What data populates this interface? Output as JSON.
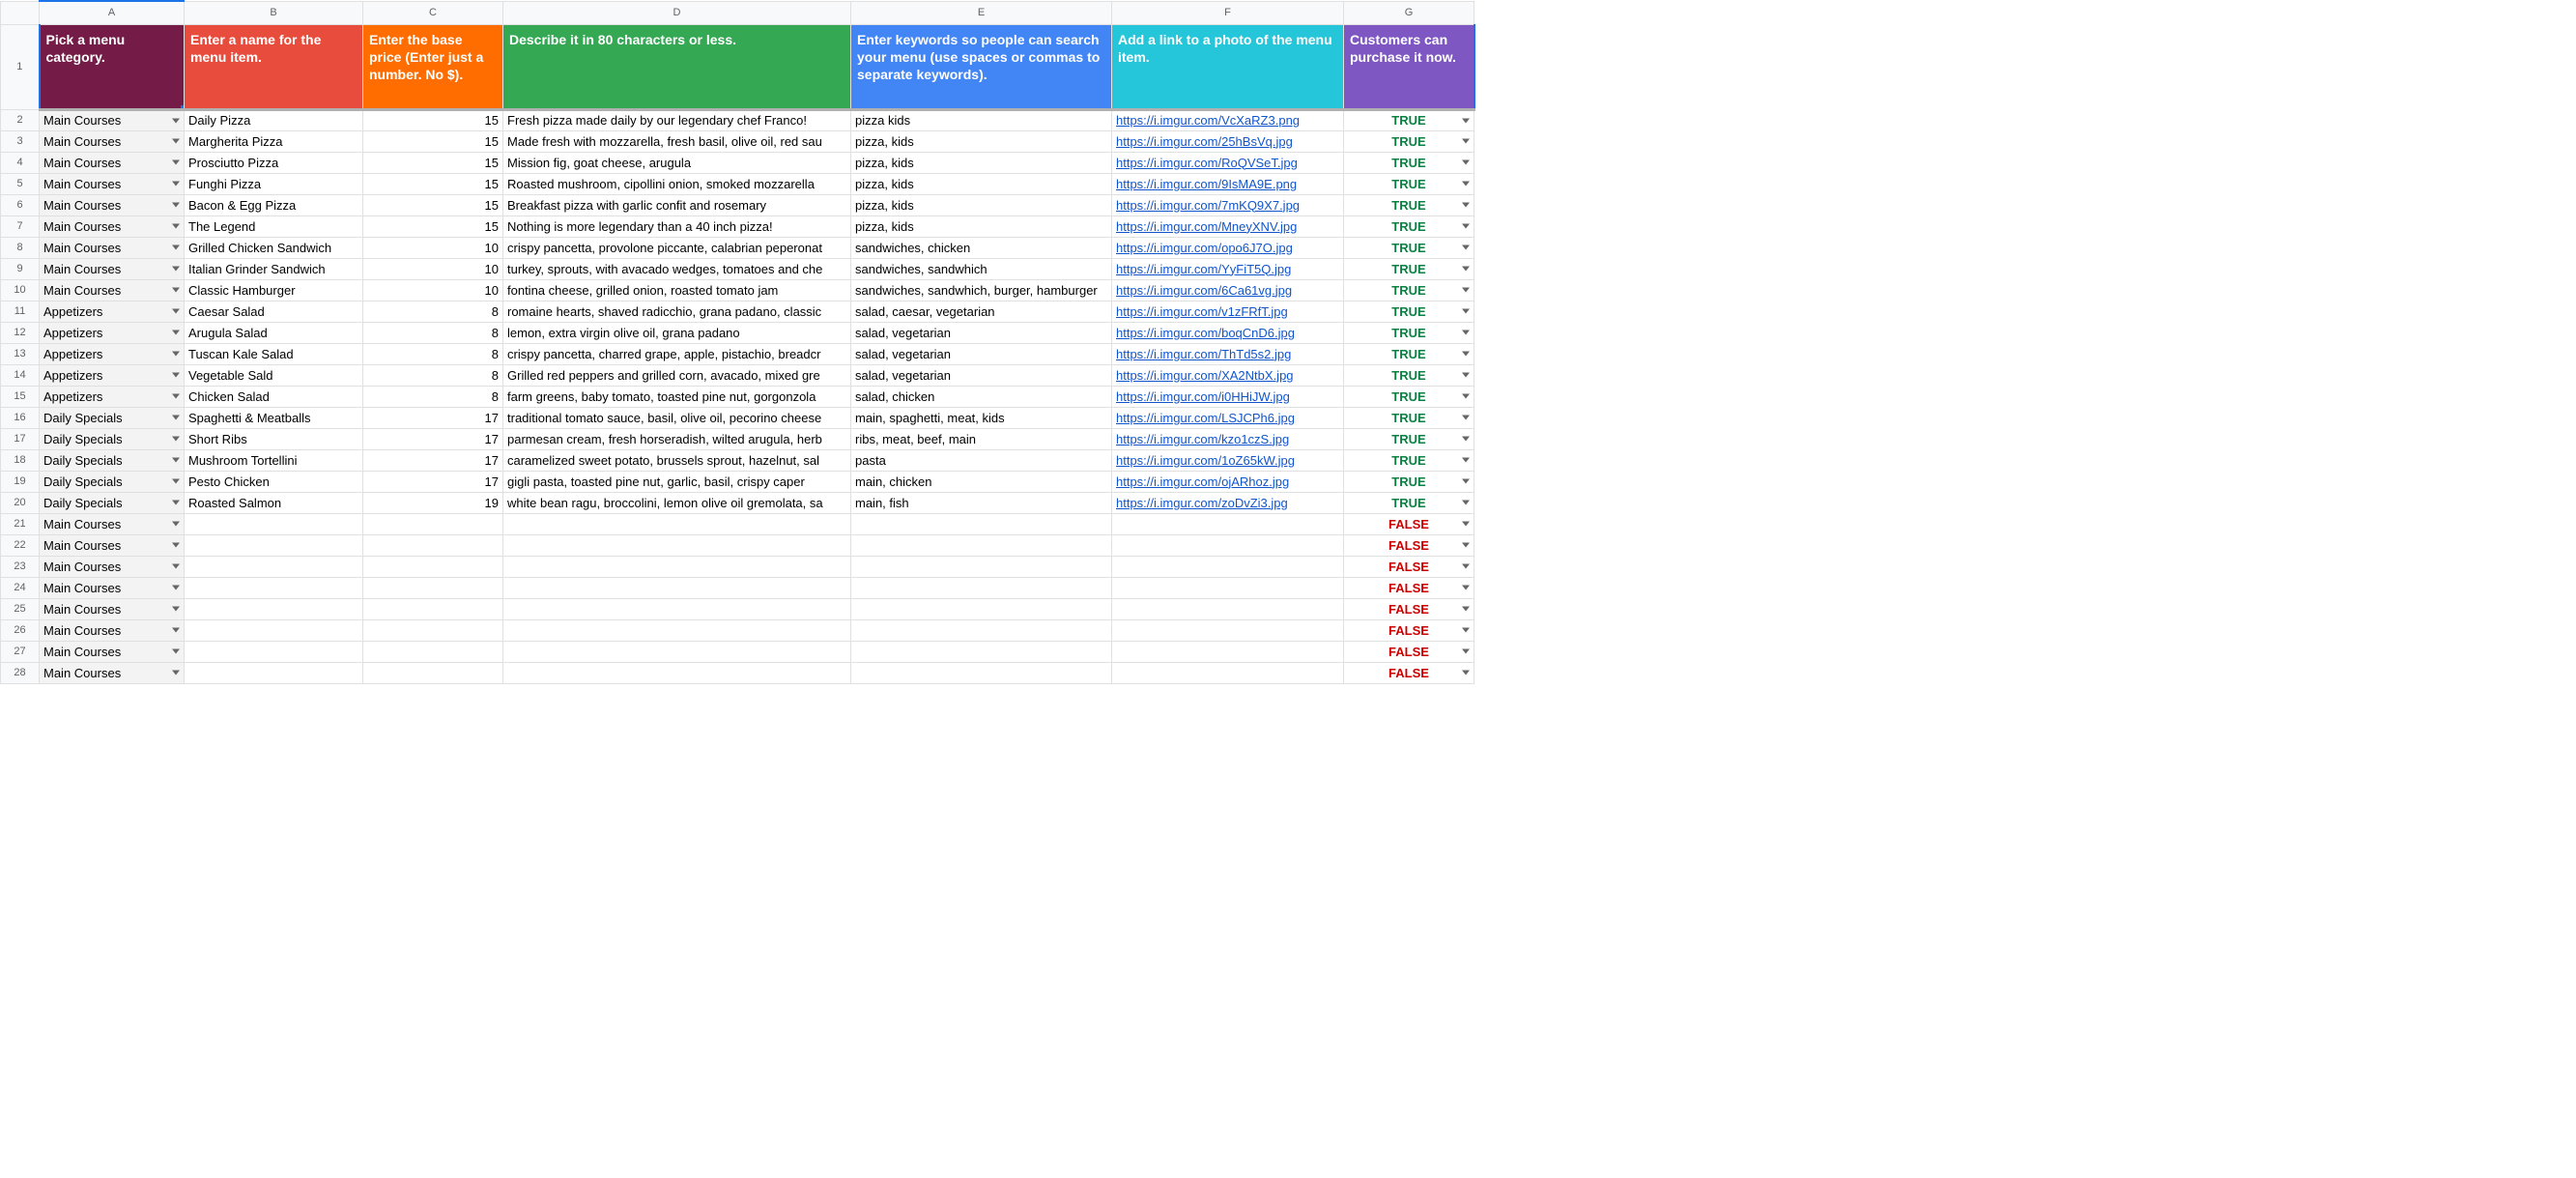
{
  "columns": [
    "A",
    "B",
    "C",
    "D",
    "E",
    "F",
    "G"
  ],
  "headers": {
    "A": "Pick a menu category.",
    "B": "Enter a name for the menu item.",
    "C": "Enter the base price (Enter just a number. No $).",
    "D": "Describe it in 80 characters or less.",
    "E": "Enter keywords so people can search your menu (use spaces or commas to separate keywords).",
    "F": "Add a link to a photo of the menu item.",
    "G": "Customers can purchase it now."
  },
  "rows": [
    {
      "n": 2,
      "cat": "Main Courses",
      "name": "Daily Pizza",
      "price": "15",
      "desc": "Fresh pizza made daily by our legendary chef Franco!",
      "kw": "pizza kids",
      "link": "https://i.imgur.com/VcXaRZ3.png",
      "purch": "TRUE"
    },
    {
      "n": 3,
      "cat": "Main Courses",
      "name": "Margherita Pizza",
      "price": "15",
      "desc": "Made fresh with mozzarella, fresh basil, olive oil, red sau",
      "kw": "pizza, kids",
      "link": "https://i.imgur.com/25hBsVq.jpg",
      "purch": "TRUE"
    },
    {
      "n": 4,
      "cat": "Main Courses",
      "name": "Prosciutto Pizza",
      "price": "15",
      "desc": "Mission fig, goat cheese, arugula",
      "kw": "pizza, kids",
      "link": "https://i.imgur.com/RoQVSeT.jpg",
      "purch": "TRUE"
    },
    {
      "n": 5,
      "cat": "Main Courses",
      "name": "Funghi Pizza",
      "price": "15",
      "desc": "Roasted mushroom, cipollini onion, smoked mozzarella",
      "kw": "pizza, kids",
      "link": "https://i.imgur.com/9IsMA9E.png",
      "purch": "TRUE"
    },
    {
      "n": 6,
      "cat": "Main Courses",
      "name": "Bacon & Egg Pizza",
      "price": "15",
      "desc": "Breakfast pizza with garlic confit and rosemary",
      "kw": "pizza, kids",
      "link": "https://i.imgur.com/7mKQ9X7.jpg",
      "purch": "TRUE"
    },
    {
      "n": 7,
      "cat": "Main Courses",
      "name": "The Legend",
      "price": "15",
      "desc": "Nothing is more legendary than a 40 inch pizza!",
      "kw": "pizza, kids",
      "link": "https://i.imgur.com/MneyXNV.jpg",
      "purch": "TRUE"
    },
    {
      "n": 8,
      "cat": "Main Courses",
      "name": "Grilled Chicken Sandwich",
      "price": "10",
      "desc": "crispy pancetta, provolone piccante, calabrian peperonat",
      "kw": "sandwiches, chicken",
      "link": "https://i.imgur.com/opo6J7O.jpg",
      "purch": "TRUE"
    },
    {
      "n": 9,
      "cat": "Main Courses",
      "name": "Italian Grinder Sandwich",
      "price": "10",
      "desc": "turkey, sprouts, with avacado wedges, tomatoes and che",
      "kw": "sandwiches, sandwhich",
      "link": "https://i.imgur.com/YyFiT5Q.jpg",
      "purch": "TRUE"
    },
    {
      "n": 10,
      "cat": "Main Courses",
      "name": "Classic Hamburger",
      "price": "10",
      "desc": "fontina cheese, grilled onion, roasted tomato jam",
      "kw": "sandwiches, sandwhich, burger, hamburger",
      "link": "https://i.imgur.com/6Ca61vg.jpg",
      "purch": "TRUE"
    },
    {
      "n": 11,
      "cat": "Appetizers",
      "name": "Caesar Salad",
      "price": "8",
      "desc": "romaine hearts, shaved radicchio, grana padano, classic",
      "kw": "salad, caesar, vegetarian",
      "link": "https://i.imgur.com/v1zFRfT.jpg",
      "purch": "TRUE"
    },
    {
      "n": 12,
      "cat": "Appetizers",
      "name": "Arugula Salad",
      "price": "8",
      "desc": "lemon, extra virgin olive oil, grana padano",
      "kw": "salad, vegetarian",
      "link": "https://i.imgur.com/boqCnD6.jpg",
      "purch": "TRUE"
    },
    {
      "n": 13,
      "cat": "Appetizers",
      "name": "Tuscan Kale Salad",
      "price": "8",
      "desc": "crispy pancetta, charred grape, apple, pistachio, breadcr",
      "kw": "salad, vegetarian",
      "link": "https://i.imgur.com/ThTd5s2.jpg",
      "purch": "TRUE"
    },
    {
      "n": 14,
      "cat": "Appetizers",
      "name": "Vegetable Sald",
      "price": "8",
      "desc": "Grilled red peppers and grilled corn, avacado, mixed gre",
      "kw": "salad, vegetarian",
      "link": "https://i.imgur.com/XA2NtbX.jpg",
      "purch": "TRUE"
    },
    {
      "n": 15,
      "cat": "Appetizers",
      "name": "Chicken Salad",
      "price": "8",
      "desc": "farm greens, baby tomato, toasted pine nut, gorgonzola",
      "kw": "salad, chicken",
      "link": "https://i.imgur.com/i0HHiJW.jpg",
      "purch": "TRUE"
    },
    {
      "n": 16,
      "cat": "Daily Specials",
      "name": "Spaghetti & Meatballs",
      "price": "17",
      "desc": "traditional tomato sauce, basil, olive oil, pecorino cheese",
      "kw": "main, spaghetti, meat, kids",
      "link": "https://i.imgur.com/LSJCPh6.jpg",
      "purch": "TRUE"
    },
    {
      "n": 17,
      "cat": "Daily Specials",
      "name": "Short Ribs",
      "price": "17",
      "desc": "parmesan cream, fresh horseradish, wilted arugula, herb",
      "kw": "ribs, meat, beef, main",
      "link": "https://i.imgur.com/kzo1czS.jpg",
      "purch": "TRUE"
    },
    {
      "n": 18,
      "cat": "Daily Specials",
      "name": "Mushroom Tortellini",
      "price": "17",
      "desc": "caramelized sweet potato, brussels sprout, hazelnut, sal",
      "kw": "pasta",
      "link": "https://i.imgur.com/1oZ65kW.jpg",
      "purch": "TRUE"
    },
    {
      "n": 19,
      "cat": "Daily Specials",
      "name": "Pesto Chicken",
      "price": "17",
      "desc": "gigli pasta, toasted pine nut, garlic, basil, crispy caper",
      "kw": "main, chicken",
      "link": "https://i.imgur.com/ojARhoz.jpg",
      "purch": "TRUE"
    },
    {
      "n": 20,
      "cat": "Daily Specials",
      "name": "Roasted Salmon",
      "price": "19",
      "desc": "white bean ragu, broccolini, lemon olive oil gremolata, sa",
      "kw": "main, fish",
      "link": "https://i.imgur.com/zoDvZi3.jpg",
      "purch": "TRUE"
    },
    {
      "n": 21,
      "cat": "Main Courses",
      "name": "",
      "price": "",
      "desc": "",
      "kw": "",
      "link": "",
      "purch": "FALSE"
    },
    {
      "n": 22,
      "cat": "Main Courses",
      "name": "",
      "price": "",
      "desc": "",
      "kw": "",
      "link": "",
      "purch": "FALSE"
    },
    {
      "n": 23,
      "cat": "Main Courses",
      "name": "",
      "price": "",
      "desc": "",
      "kw": "",
      "link": "",
      "purch": "FALSE"
    },
    {
      "n": 24,
      "cat": "Main Courses",
      "name": "",
      "price": "",
      "desc": "",
      "kw": "",
      "link": "",
      "purch": "FALSE"
    },
    {
      "n": 25,
      "cat": "Main Courses",
      "name": "",
      "price": "",
      "desc": "",
      "kw": "",
      "link": "",
      "purch": "FALSE"
    },
    {
      "n": 26,
      "cat": "Main Courses",
      "name": "",
      "price": "",
      "desc": "",
      "kw": "",
      "link": "",
      "purch": "FALSE"
    },
    {
      "n": 27,
      "cat": "Main Courses",
      "name": "",
      "price": "",
      "desc": "",
      "kw": "",
      "link": "",
      "purch": "FALSE"
    },
    {
      "n": 28,
      "cat": "Main Courses",
      "name": "",
      "price": "",
      "desc": "",
      "kw": "",
      "link": "",
      "purch": "FALSE"
    }
  ]
}
